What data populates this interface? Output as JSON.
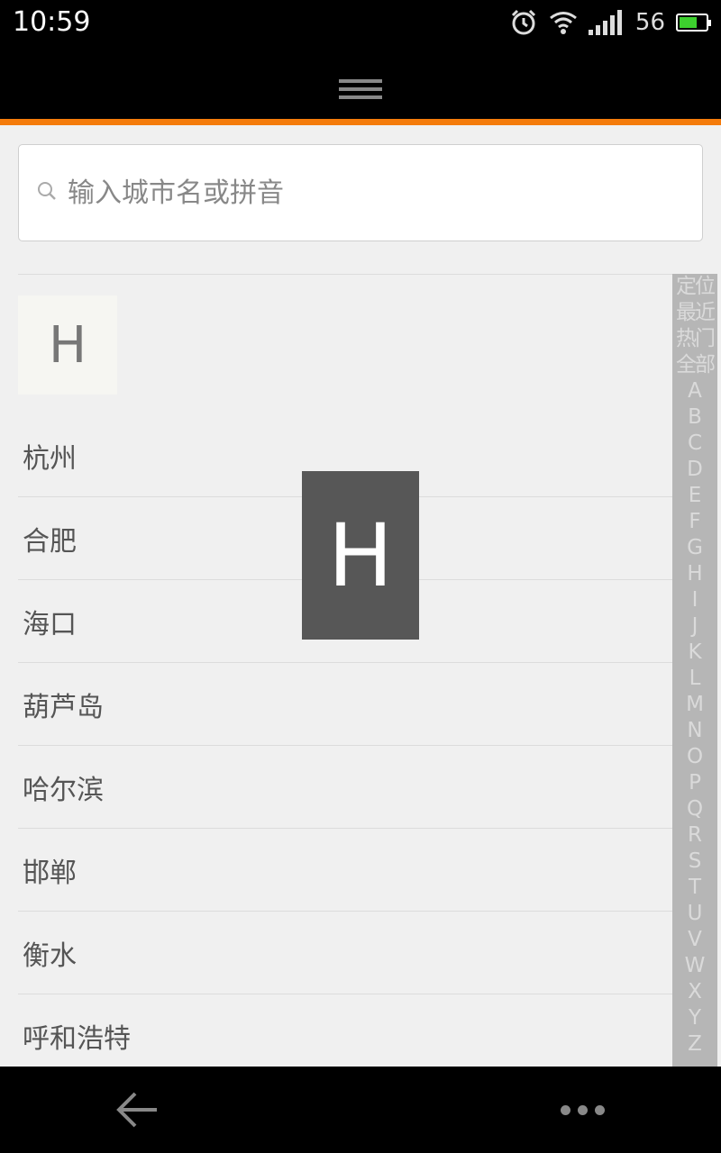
{
  "status_bar": {
    "time": "10:59",
    "battery_percent": "56",
    "icons": [
      "alarm-icon",
      "wifi-icon",
      "signal-icon",
      "battery-icon"
    ],
    "battery_color": "#3dd12e"
  },
  "action_bar": {
    "menu_icon": "menu-icon"
  },
  "colors": {
    "accent": "#f47b0b",
    "background": "#f0f0f0",
    "index_bar": "#b6b6b6",
    "overlay": "#575757"
  },
  "search": {
    "placeholder": "输入城市名或拼音",
    "value": ""
  },
  "list": {
    "section_header": "H",
    "cities": [
      "杭州",
      "合肥",
      "海口",
      "葫芦岛",
      "哈尔滨",
      "邯郸",
      "衡水",
      "呼和浩特"
    ]
  },
  "index_bar": {
    "items": [
      "定位",
      "最近",
      "热门",
      "全部",
      "A",
      "B",
      "C",
      "D",
      "E",
      "F",
      "G",
      "H",
      "I",
      "J",
      "K",
      "L",
      "M",
      "N",
      "O",
      "P",
      "Q",
      "R",
      "S",
      "T",
      "U",
      "V",
      "W",
      "X",
      "Y",
      "Z"
    ]
  },
  "overlay_letter": "H",
  "nav_bar": {
    "back_icon": "back-arrow-icon",
    "more_icon": "more-dots-icon"
  }
}
